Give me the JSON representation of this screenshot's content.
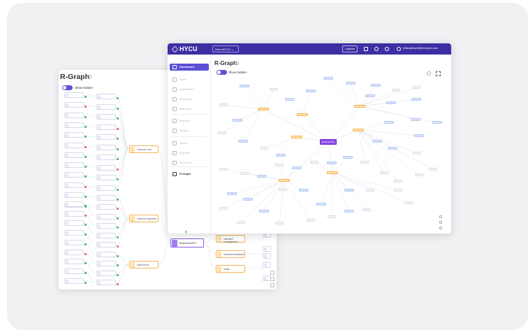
{
  "tree_view": {
    "title": "R-Graph",
    "toggle_label": "Show hidden",
    "hub_nodes": [
      "Vsphere1.abc",
      "vSphere-hyperflex",
      "ISaaS/vVol"
    ],
    "root_node": "BusinessVPro",
    "right_nodes": [
      "standard management",
      "Standard database",
      "Mage"
    ]
  },
  "app": {
    "brand": "HYCU",
    "tenant": "DemoHYCU",
    "upgrade_label": "Upgrade",
    "user_email": "bella.gibson@demohycu.com",
    "page_title": "R-Graph",
    "toggle_label": "Show hidden",
    "central_node": "BusinessVPro",
    "sidebar": [
      {
        "label": "Dashboard",
        "icon": "dashboard-icon",
        "state": "active"
      },
      {
        "label": "Stack",
        "icon": "stack-icon",
        "state": "muted"
      },
      {
        "label": "Applications",
        "icon": "applications-icon",
        "state": "muted"
      },
      {
        "label": "Encryption",
        "icon": "encryption-icon",
        "state": "muted"
      },
      {
        "label": "Branches",
        "icon": "branches-icon",
        "state": "muted"
      },
      {
        "label": "Backups",
        "icon": "backups-icon",
        "state": "muted"
      },
      {
        "label": "Targets",
        "icon": "targets-icon",
        "state": "muted"
      },
      {
        "label": "Tables",
        "icon": "tables-icon",
        "state": "muted"
      },
      {
        "label": "Reports",
        "icon": "reports-icon",
        "state": "muted"
      },
      {
        "label": "Recovery",
        "icon": "recovery-icon",
        "state": "muted"
      },
      {
        "label": "R-Graph",
        "icon": "r-graph-icon",
        "state": "dark"
      }
    ]
  },
  "colors": {
    "brand_purple": "#3d2fa3",
    "active_purple": "#5b4fd6",
    "hub_orange": "#f5b546",
    "leaf_blue": "#d6e3fb",
    "root_violet": "#8b4be8",
    "status_green": "#2fb37a",
    "status_red": "#e8574a"
  }
}
